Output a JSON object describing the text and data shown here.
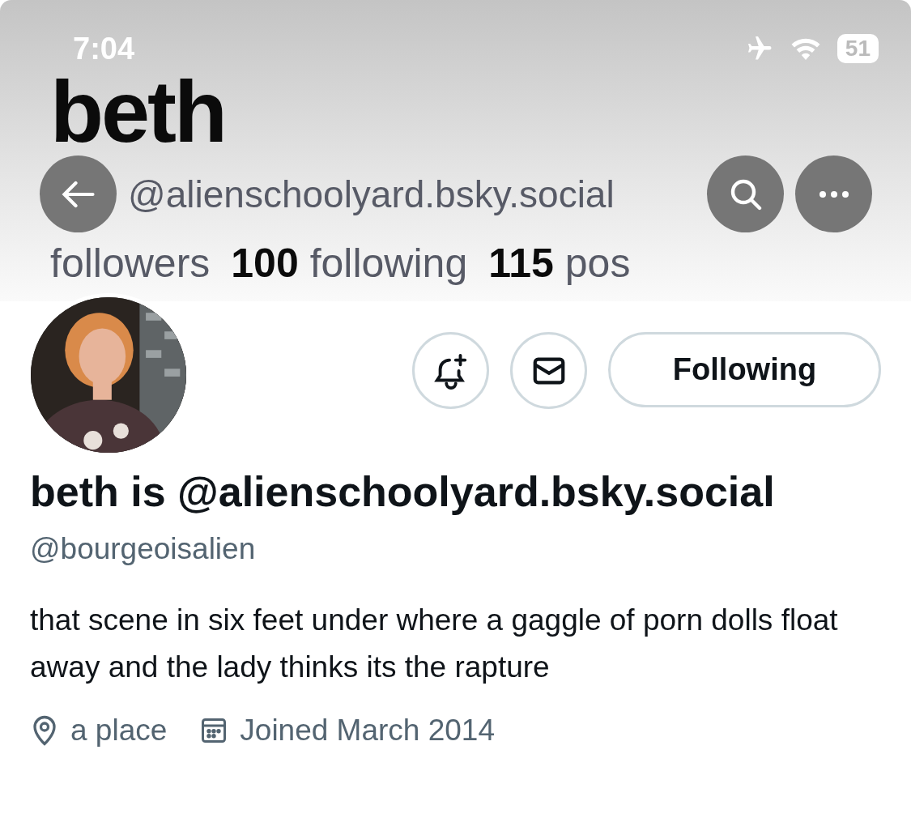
{
  "status_bar": {
    "time": "7:04",
    "battery": "51"
  },
  "header": {
    "title": "beth",
    "handle": "@alienschoolyard.bsky.social",
    "stats": [
      {
        "label": "followers"
      },
      {
        "count": "100",
        "label": "following"
      },
      {
        "count": "115",
        "label": "pos"
      }
    ]
  },
  "profile": {
    "follow_button": "Following",
    "name": "beth is @alienschoolyard.bsky.social",
    "handle": "@bourgeoisalien",
    "bio": "that scene in six feet under where a gaggle of porn dolls float away and the lady thinks its the rapture",
    "meta": [
      {
        "kind": "location",
        "text": "a place"
      },
      {
        "kind": "joined",
        "text": "Joined March 2014"
      }
    ]
  }
}
